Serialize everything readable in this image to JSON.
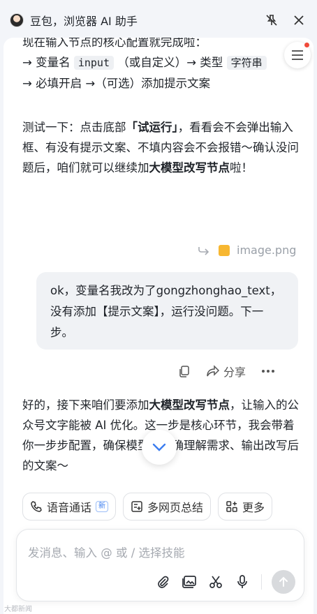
{
  "header": {
    "title": "豆包，浏览器 AI 助手"
  },
  "chat": {
    "para1_line1": "现在输入节点的核心配置就完成啦：",
    "para1_l2_prefix": "→ 变量名",
    "para1_l2_code1": "input",
    "para1_l2_mid": "（或自定义）→ 类型",
    "para1_l2_code2": "字符串",
    "para1_l3": "→ 必填开启 →（可选）添加提示文案",
    "para2_a": "测试一下：点击底部",
    "para2_b": "「试运行」",
    "para2_c": "，看看会不会弹出输入框、有没有提示文案、不填内容会不会报错～确认没问题后，咱们就可以继续加",
    "para2_d": "大模型改写节点",
    "para2_e": "啦！",
    "attachment_name": "image.png",
    "user_message": "ok，变量名我改为了gongzhonghao_text，没有添加【提示文案】，运行没问题。下一步。",
    "share_label": "分享",
    "para3_a": "好的，接下来咱们要添加",
    "para3_b": "大模型改写节点",
    "para3_c": "，让输入的公众号文字能被 AI 优化。这一步是核心环节，我会带着你一步步配置，确保模型能准确理解需求、输出改写后的文案～"
  },
  "chips": {
    "voice_call": "语音通话",
    "voice_badge": "新",
    "multi_page": "多网页总结",
    "more": "更多"
  },
  "input": {
    "placeholder": "发消息、输入 @ 或 / 选择技能"
  },
  "watermark": "大都新闻",
  "colors": {
    "badge_red": "#f04a3a",
    "accent_blue": "#3b7df0",
    "send_disabled": "#d8dadd"
  }
}
